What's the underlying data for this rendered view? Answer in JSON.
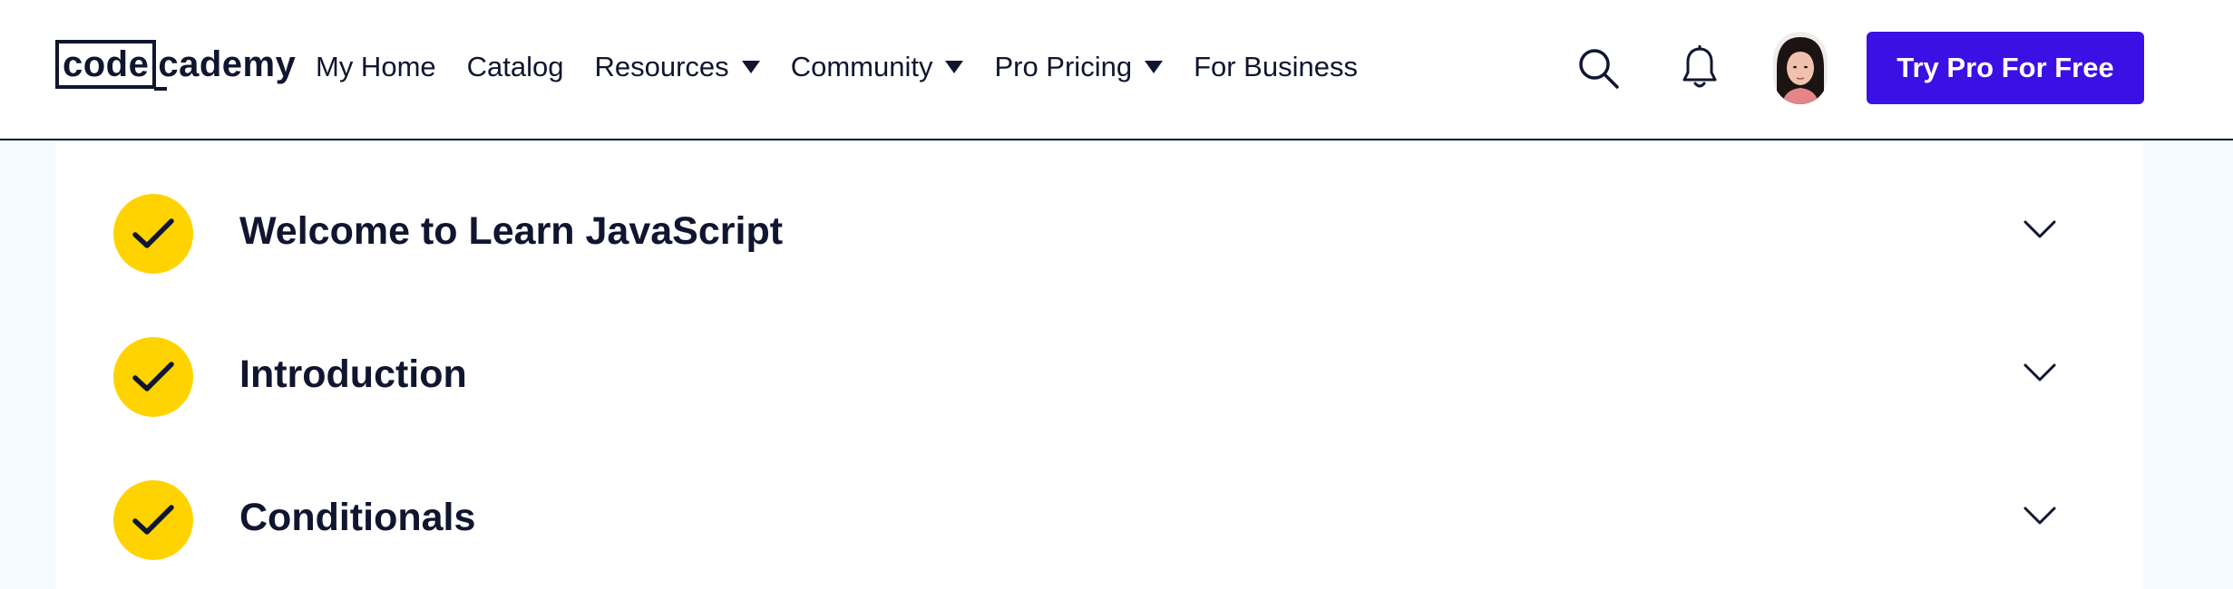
{
  "header": {
    "logo": {
      "part1": "code",
      "part2": "cademy"
    },
    "nav": [
      {
        "label": "My Home",
        "has_dropdown": false
      },
      {
        "label": "Catalog",
        "has_dropdown": false
      },
      {
        "label": "Resources",
        "has_dropdown": true
      },
      {
        "label": "Community",
        "has_dropdown": true
      },
      {
        "label": "Pro Pricing",
        "has_dropdown": true
      },
      {
        "label": "For Business",
        "has_dropdown": false
      }
    ],
    "icons": [
      "search-icon",
      "bell-icon"
    ],
    "cta_label": "Try Pro For Free"
  },
  "modules": [
    {
      "title": "Welcome to Learn JavaScript",
      "completed": true
    },
    {
      "title": "Introduction",
      "completed": true
    },
    {
      "title": "Conditionals",
      "completed": true
    }
  ],
  "colors": {
    "brand_navy": "#10162f",
    "cta_blue": "#3a10e5",
    "check_yellow": "#ffd300",
    "page_bg": "#f5fcff"
  }
}
